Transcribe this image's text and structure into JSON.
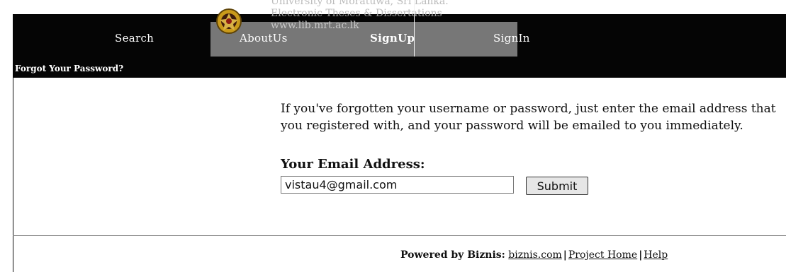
{
  "watermark": {
    "line1": "University of Moratuwa, Sri Lanka.",
    "line2": "Electronic Theses & Dissertations",
    "line3": "www.lib.mrt.ac.lk"
  },
  "nav": {
    "search": "Search",
    "aboutus": "AboutUs",
    "signup": "SignUp",
    "signin": "SignIn"
  },
  "forgot": {
    "title": "Forgot Your Password?"
  },
  "content": {
    "instruction": "If you've forgotten your username or password, just enter the email address that you registered with, and your password will be emailed to you immediately.",
    "email_label": "Your Email Address:",
    "email_value": "vistau4@gmail.com",
    "submit_label": "Submit"
  },
  "footer": {
    "powered_by": "Powered by Biznis:",
    "biznis_link": "biznis.com",
    "project_home_link": "Project Home",
    "help_link": "Help"
  }
}
